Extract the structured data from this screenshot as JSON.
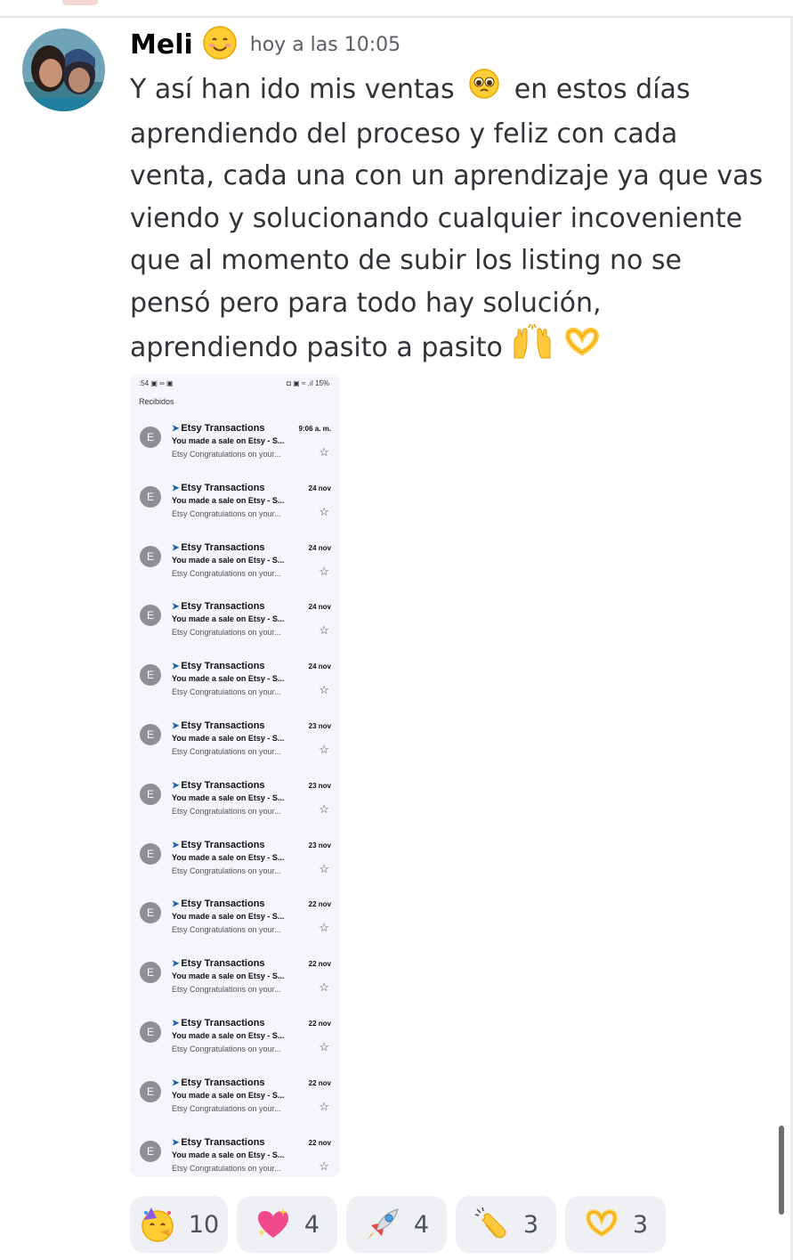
{
  "message": {
    "author": "Meli",
    "author_emoji_icon": "smiling-face-icon",
    "timestamp": "hoy a las 10:05",
    "lines": [
      "Y así han ido mis ventas",
      "en estos días",
      "aprendiendo del proceso y feliz con cada",
      "venta, cada una con un aprendizaje ya que vas",
      "viendo y solucionando cualquier incoveniente",
      "que al momento de subir los listing no se",
      "pensó pero para todo hay solución,",
      "aprendiendo pasito a pasito"
    ],
    "inline_emojis": [
      "pleading-face-icon",
      "raising-hands-icon",
      "heart-hands-icon"
    ]
  },
  "attachment": {
    "status_left": ":54 ▣ ∞ ▣",
    "status_right": "◘ ▣ ≈ .ıl 15%",
    "inbox_title": "Recibidos",
    "emails": [
      {
        "avatar": "E",
        "sender": "Etsy Transactions",
        "date": "9:06 a. m.",
        "subject": "You made a sale on Etsy - S...",
        "preview": "Etsy Congratulations on your..."
      },
      {
        "avatar": "E",
        "sender": "Etsy Transactions",
        "date": "24 nov",
        "subject": "You made a sale on Etsy - S...",
        "preview": "Etsy Congratulations on your..."
      },
      {
        "avatar": "E",
        "sender": "Etsy Transactions",
        "date": "24 nov",
        "subject": "You made a sale on Etsy - S...",
        "preview": "Etsy Congratulations on your..."
      },
      {
        "avatar": "E",
        "sender": "Etsy Transactions",
        "date": "24 nov",
        "subject": "You made a sale on Etsy - S...",
        "preview": "Etsy Congratulations on your..."
      },
      {
        "avatar": "E",
        "sender": "Etsy Transactions",
        "date": "24 nov",
        "subject": "You made a sale on Etsy - S...",
        "preview": "Etsy Congratulations on your..."
      },
      {
        "avatar": "E",
        "sender": "Etsy Transactions",
        "date": "23 nov",
        "subject": "You made a sale on Etsy - S...",
        "preview": "Etsy Congratulations on your..."
      },
      {
        "avatar": "E",
        "sender": "Etsy Transactions",
        "date": "23 nov",
        "subject": "You made a sale on Etsy - S...",
        "preview": "Etsy Congratulations on your..."
      },
      {
        "avatar": "E",
        "sender": "Etsy Transactions",
        "date": "23 nov",
        "subject": "You made a sale on Etsy - S...",
        "preview": "Etsy Congratulations on your..."
      },
      {
        "avatar": "E",
        "sender": "Etsy Transactions",
        "date": "22 nov",
        "subject": "You made a sale on Etsy - S...",
        "preview": "Etsy Congratulations on your..."
      },
      {
        "avatar": "E",
        "sender": "Etsy Transactions",
        "date": "22 nov",
        "subject": "You made a sale on Etsy - S...",
        "preview": "Etsy Congratulations on your..."
      },
      {
        "avatar": "E",
        "sender": "Etsy Transactions",
        "date": "22 nov",
        "subject": "You made a sale on Etsy - S...",
        "preview": "Etsy Congratulations on your..."
      },
      {
        "avatar": "E",
        "sender": "Etsy Transactions",
        "date": "22 nov",
        "subject": "You made a sale on Etsy - S...",
        "preview": "Etsy Congratulations on your..."
      },
      {
        "avatar": "E",
        "sender": "Etsy Transactions",
        "date": "22 nov",
        "subject": "You made a sale on Etsy - S...",
        "preview": "Etsy Congratulations on your..."
      }
    ]
  },
  "reactions": [
    {
      "icon": "partying-face-icon",
      "count": "10"
    },
    {
      "icon": "sparkling-heart-icon",
      "count": "4"
    },
    {
      "icon": "rocket-icon",
      "count": "4"
    },
    {
      "icon": "clapping-hands-icon",
      "count": "3"
    },
    {
      "icon": "heart-hands-icon",
      "count": "3"
    }
  ],
  "colors": {
    "author": "#060607",
    "timestamp": "#5c5e66",
    "message_text": "#313338",
    "reaction_bg": "#eef0f3",
    "etsy_chevron": "#1a5fa8"
  }
}
